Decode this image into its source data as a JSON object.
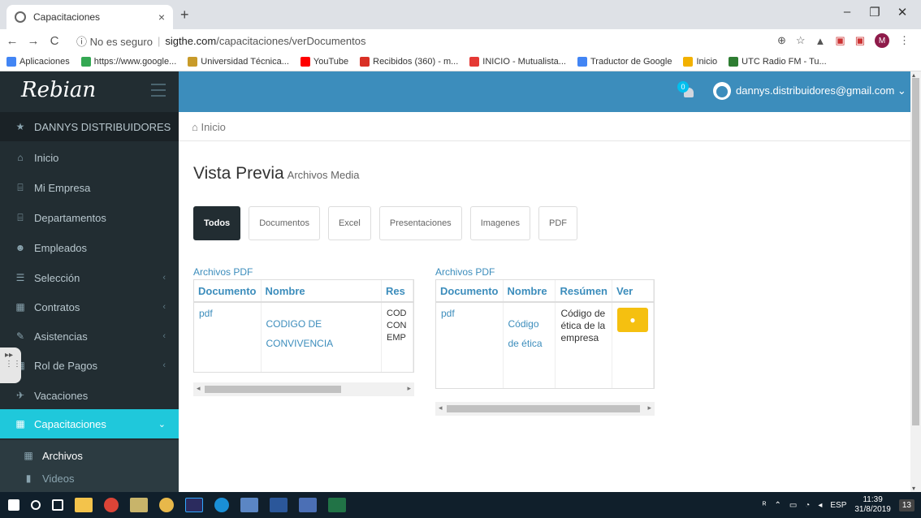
{
  "browser": {
    "tab_title": "Capacitaciones",
    "tab_close": "×",
    "new_tab": "+",
    "minimize": "–",
    "restore": "❐",
    "close": "✕",
    "back": "←",
    "forward": "→",
    "reload": "C",
    "security": "ⓘ No es seguro",
    "url_host": "sigthe.com",
    "url_path": "/capacitaciones/verDocumentos",
    "profile_initial": "M",
    "bookmarks": [
      "Aplicaciones",
      "https://www.google...",
      "Universidad Técnica...",
      "YouTube",
      "Recibidos (360) - m...",
      "INICIO - Mutualista...",
      "Traductor de Google",
      "Inicio",
      "UTC Radio FM - Tu..."
    ]
  },
  "app": {
    "logo": "Rebian",
    "notif_count": "0",
    "user_email": "dannys.distribuidores@gmail.com ⌄"
  },
  "sidebar": {
    "company": "DANNYS DISTRIBUIDORES",
    "items": [
      "Inicio",
      "Mi Empresa",
      "Departamentos",
      "Empleados",
      "Selección",
      "Contratos",
      "Asistencias",
      "Rol de Pagos",
      "Vacaciones",
      "Capacitaciones"
    ],
    "sub": [
      "Archivos",
      "Videos"
    ]
  },
  "content": {
    "breadcrumb": "Inicio",
    "title": "Vista Previa",
    "subtitle": "Archivos Media",
    "tabs": [
      "Todos",
      "Documentos",
      "Excel",
      "Presentaciones",
      "Imagenes",
      "PDF"
    ],
    "panel1": {
      "title": "Archivos PDF",
      "headers": [
        "Documento",
        "Nombre",
        "Res"
      ],
      "doc": "pdf",
      "name": "CODIGO DE CONVIVENCIA",
      "desc": "COD CON EMP"
    },
    "panel2": {
      "title": "Archivos PDF",
      "headers": [
        "Documento",
        "Nombre",
        "Resúmen",
        "Ver"
      ],
      "doc": "pdf",
      "name": "Código de ética",
      "desc": "Código de ética de la empresa"
    }
  },
  "taskbar": {
    "lang": "ESP",
    "time": "11:39",
    "date": "31/8/2019",
    "notif": "13"
  }
}
